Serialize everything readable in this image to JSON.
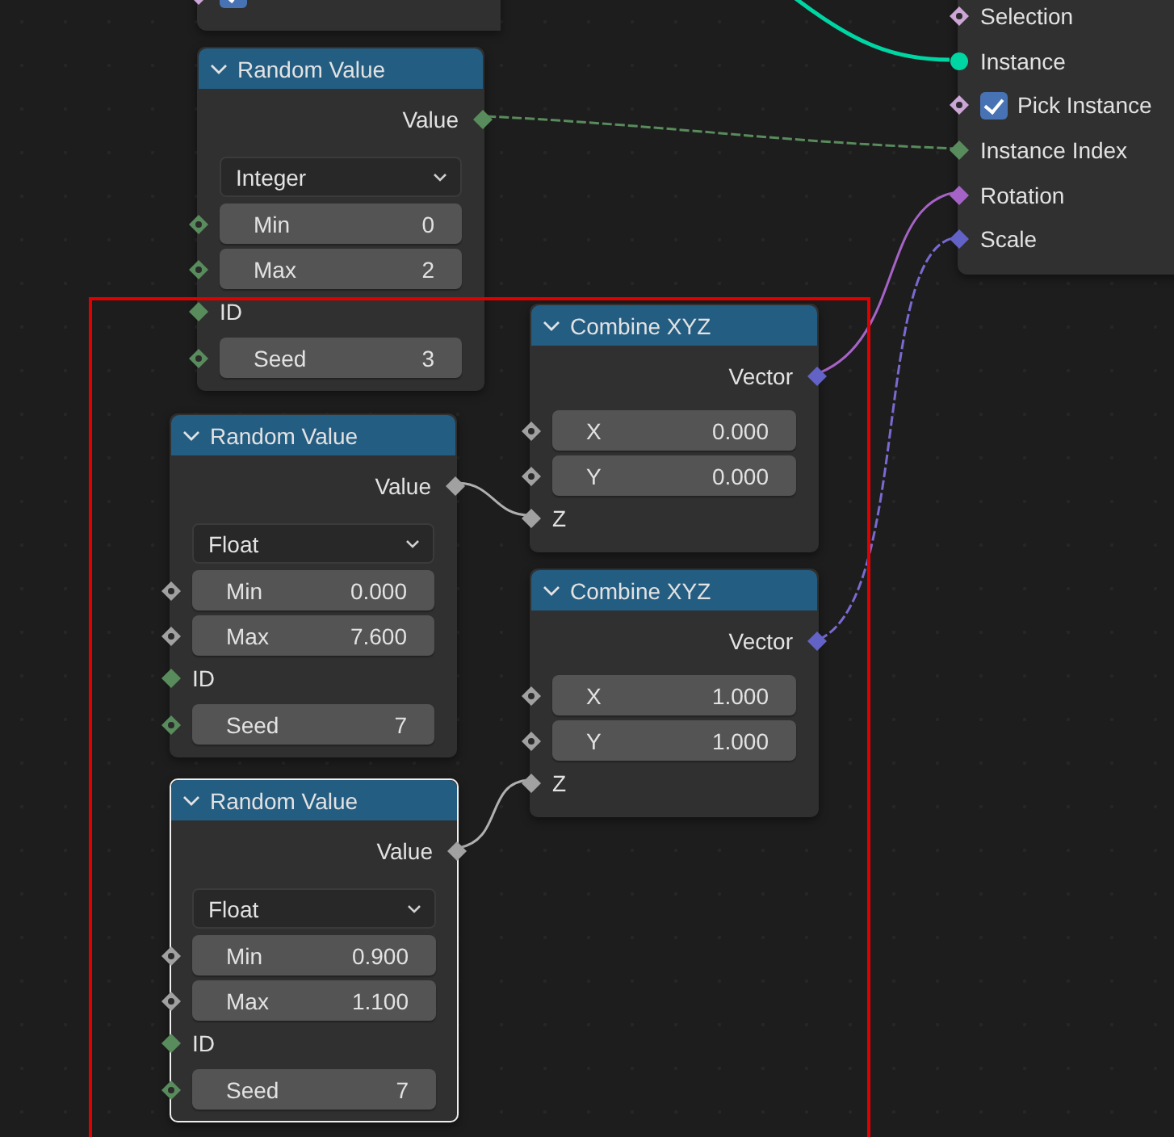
{
  "nodes": [
    {
      "kind": "partial",
      "rows": [
        {
          "kind": "checkbox",
          "checked": true,
          "socket": {
            "kind": "diamond_dot",
            "color": "#cca6d6"
          }
        }
      ]
    },
    {
      "kind": "partial",
      "rows": [
        {
          "kind": "input",
          "label": "Selection",
          "socket": {
            "kind": "diamond_dot",
            "color": "#cca6d6"
          }
        },
        {
          "kind": "input",
          "label": "Instance",
          "socket": {
            "kind": "circle",
            "color": "#00d6a3"
          }
        },
        {
          "kind": "checkbox",
          "label": "Pick Instance",
          "checked": true,
          "socket": {
            "kind": "diamond_dot",
            "color": "#cca6d6"
          }
        },
        {
          "kind": "input",
          "label": "Instance Index",
          "socket": {
            "kind": "diamond",
            "color": "#598c5c"
          }
        },
        {
          "kind": "input",
          "label": "Rotation",
          "socket": {
            "kind": "diamond",
            "color": "#a663c7"
          }
        },
        {
          "kind": "input",
          "label": "Scale",
          "socket": {
            "kind": "diamond",
            "color": "#6363c7"
          }
        }
      ]
    },
    {
      "kind": "full",
      "title": "Random Value",
      "expanded": true,
      "selected": false,
      "rows": [
        {
          "kind": "output",
          "label": "Value",
          "socket": {
            "kind": "diamond",
            "color": "#598c5c"
          }
        },
        {
          "kind": "dropdown",
          "value": "Integer"
        },
        {
          "kind": "field",
          "label": "Min",
          "value": "0",
          "socket": {
            "kind": "diamond_dot",
            "color": "#598c5c"
          }
        },
        {
          "kind": "field",
          "label": "Max",
          "value": "2",
          "socket": {
            "kind": "diamond_dot",
            "color": "#598c5c"
          }
        },
        {
          "kind": "input",
          "label": "ID",
          "socket": {
            "kind": "diamond",
            "color": "#598c5c"
          }
        },
        {
          "kind": "field",
          "label": "Seed",
          "value": "3",
          "socket": {
            "kind": "diamond_dot",
            "color": "#598c5c"
          }
        }
      ]
    },
    {
      "kind": "full",
      "title": "Combine XYZ",
      "expanded": true,
      "selected": false,
      "rows": [
        {
          "kind": "output",
          "label": "Vector",
          "socket": {
            "kind": "diamond",
            "color": "#6363c7"
          }
        },
        {
          "kind": "field",
          "label": "X",
          "value": "0.000",
          "socket": {
            "kind": "diamond_dot",
            "color": "#a1a1a1"
          }
        },
        {
          "kind": "field",
          "label": "Y",
          "value": "0.000",
          "socket": {
            "kind": "diamond_dot",
            "color": "#a1a1a1"
          }
        },
        {
          "kind": "input",
          "label": "Z",
          "socket": {
            "kind": "diamond",
            "color": "#a1a1a1"
          }
        }
      ]
    },
    {
      "kind": "full",
      "title": "Random Value",
      "expanded": true,
      "selected": false,
      "rows": [
        {
          "kind": "output",
          "label": "Value",
          "socket": {
            "kind": "diamond",
            "color": "#a1a1a1"
          }
        },
        {
          "kind": "dropdown",
          "value": "Float"
        },
        {
          "kind": "field",
          "label": "Min",
          "value": "0.000",
          "socket": {
            "kind": "diamond_dot",
            "color": "#a1a1a1"
          }
        },
        {
          "kind": "field",
          "label": "Max",
          "value": "7.600",
          "socket": {
            "kind": "diamond_dot",
            "color": "#a1a1a1"
          }
        },
        {
          "kind": "input",
          "label": "ID",
          "socket": {
            "kind": "diamond",
            "color": "#598c5c"
          }
        },
        {
          "kind": "field",
          "label": "Seed",
          "value": "7",
          "socket": {
            "kind": "diamond_dot",
            "color": "#598c5c"
          }
        }
      ]
    },
    {
      "kind": "full",
      "title": "Combine XYZ",
      "expanded": true,
      "selected": false,
      "rows": [
        {
          "kind": "output",
          "label": "Vector",
          "socket": {
            "kind": "diamond",
            "color": "#6363c7"
          }
        },
        {
          "kind": "field",
          "label": "X",
          "value": "1.000",
          "socket": {
            "kind": "diamond_dot",
            "color": "#a1a1a1"
          }
        },
        {
          "kind": "field",
          "label": "Y",
          "value": "1.000",
          "socket": {
            "kind": "diamond_dot",
            "color": "#a1a1a1"
          }
        },
        {
          "kind": "input",
          "label": "Z",
          "socket": {
            "kind": "diamond",
            "color": "#a1a1a1"
          }
        }
      ]
    },
    {
      "kind": "full",
      "title": "Random Value",
      "expanded": true,
      "selected": true,
      "rows": [
        {
          "kind": "output",
          "label": "Value",
          "socket": {
            "kind": "diamond",
            "color": "#a1a1a1"
          }
        },
        {
          "kind": "dropdown",
          "value": "Float"
        },
        {
          "kind": "field",
          "label": "Min",
          "value": "0.900",
          "socket": {
            "kind": "diamond_dot",
            "color": "#a1a1a1"
          }
        },
        {
          "kind": "field",
          "label": "Max",
          "value": "1.100",
          "socket": {
            "kind": "diamond_dot",
            "color": "#a1a1a1"
          }
        },
        {
          "kind": "input",
          "label": "ID",
          "socket": {
            "kind": "diamond",
            "color": "#598c5c"
          }
        },
        {
          "kind": "field",
          "label": "Seed",
          "value": "7",
          "socket": {
            "kind": "diamond_dot",
            "color": "#598c5c"
          }
        }
      ]
    }
  ]
}
